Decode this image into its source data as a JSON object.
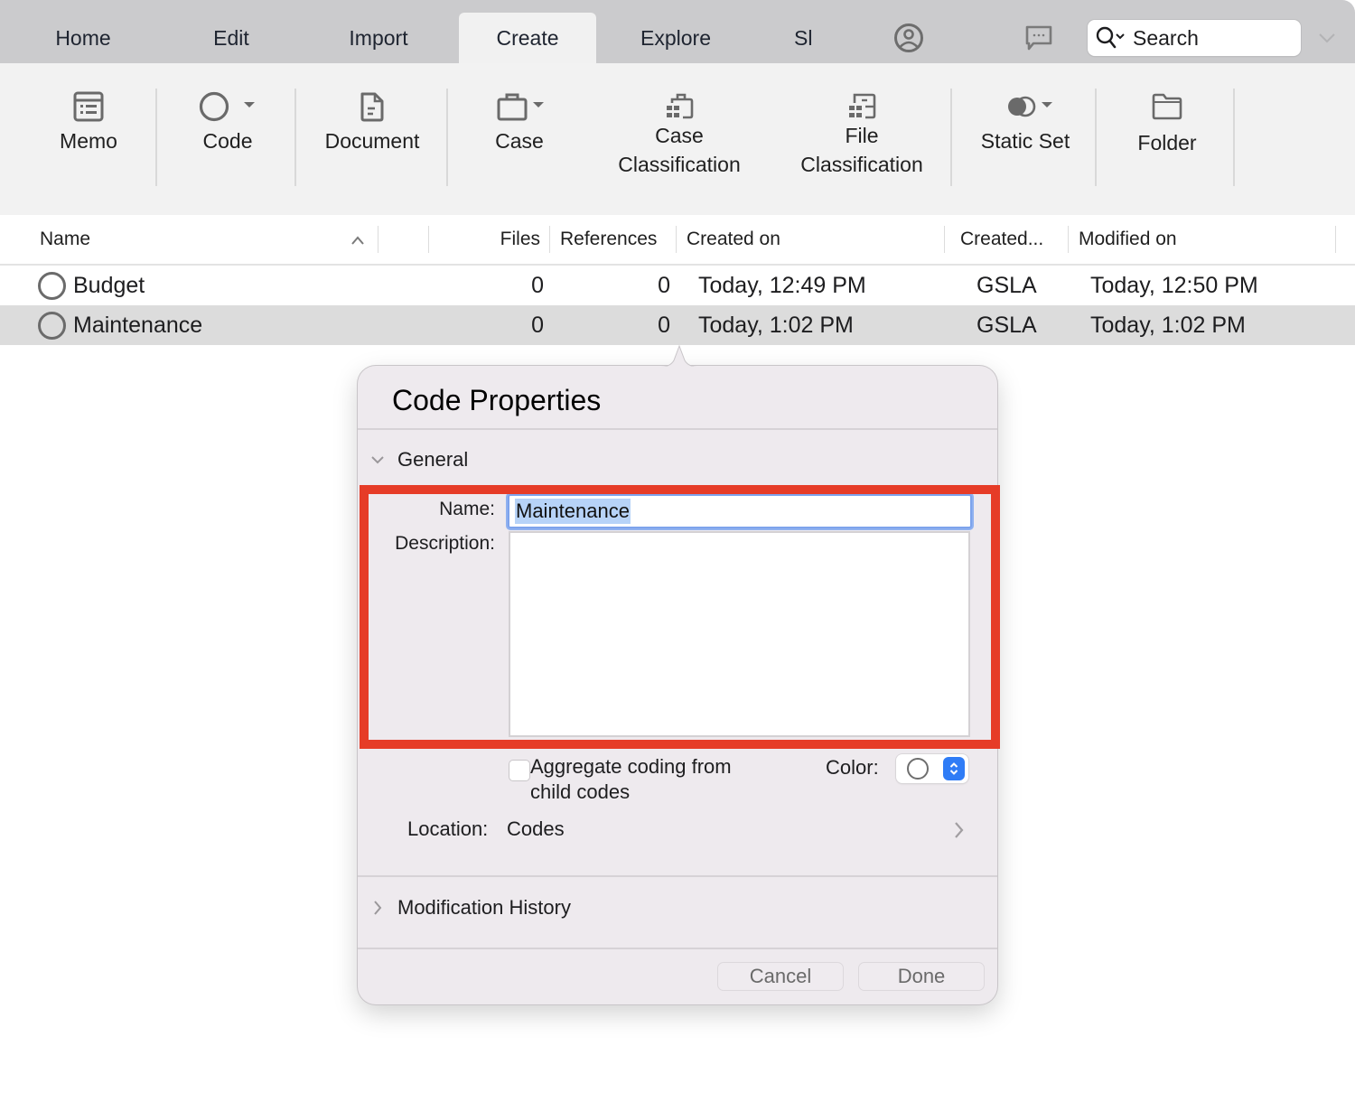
{
  "tabs": {
    "items": [
      {
        "label": "Home"
      },
      {
        "label": "Edit"
      },
      {
        "label": "Import"
      },
      {
        "label": "Create",
        "active": true
      },
      {
        "label": "Explore"
      },
      {
        "label": "Sl"
      }
    ],
    "search_placeholder": "Search"
  },
  "ribbon": {
    "memo": "Memo",
    "code": "Code",
    "document": "Document",
    "case": "Case",
    "case_classification_1": "Case",
    "case_classification_2": "Classification",
    "file_classification_1": "File",
    "file_classification_2": "Classification",
    "static_set": "Static Set",
    "folder": "Folder"
  },
  "table": {
    "columns": {
      "name": "Name",
      "files": "Files",
      "references": "References",
      "created_on": "Created on",
      "created_by": "Created...",
      "modified_on": "Modified on"
    },
    "rows": [
      {
        "name": "Budget",
        "files": "0",
        "references": "0",
        "created_on": "Today, 12:49 PM",
        "created_by": "GSLA",
        "modified_on": "Today, 12:50 PM",
        "selected": false
      },
      {
        "name": "Maintenance",
        "files": "0",
        "references": "0",
        "created_on": "Today, 1:02 PM",
        "created_by": "GSLA",
        "modified_on": "Today, 1:02 PM",
        "selected": true
      }
    ]
  },
  "popover": {
    "title": "Code Properties",
    "general_section": "General",
    "name_label": "Name:",
    "name_value": "Maintenance",
    "description_label": "Description:",
    "description_value": "",
    "aggregate_label": "Aggregate coding from child codes",
    "aggregate_checked": false,
    "color_label": "Color:",
    "location_label": "Location:",
    "location_value": "Codes",
    "history_section": "Modification History",
    "cancel": "Cancel",
    "done": "Done"
  },
  "colors": {
    "highlight_box": "#e63c27",
    "selection": "#b7d3f8",
    "stepper_accent": "#2f7cf6"
  }
}
